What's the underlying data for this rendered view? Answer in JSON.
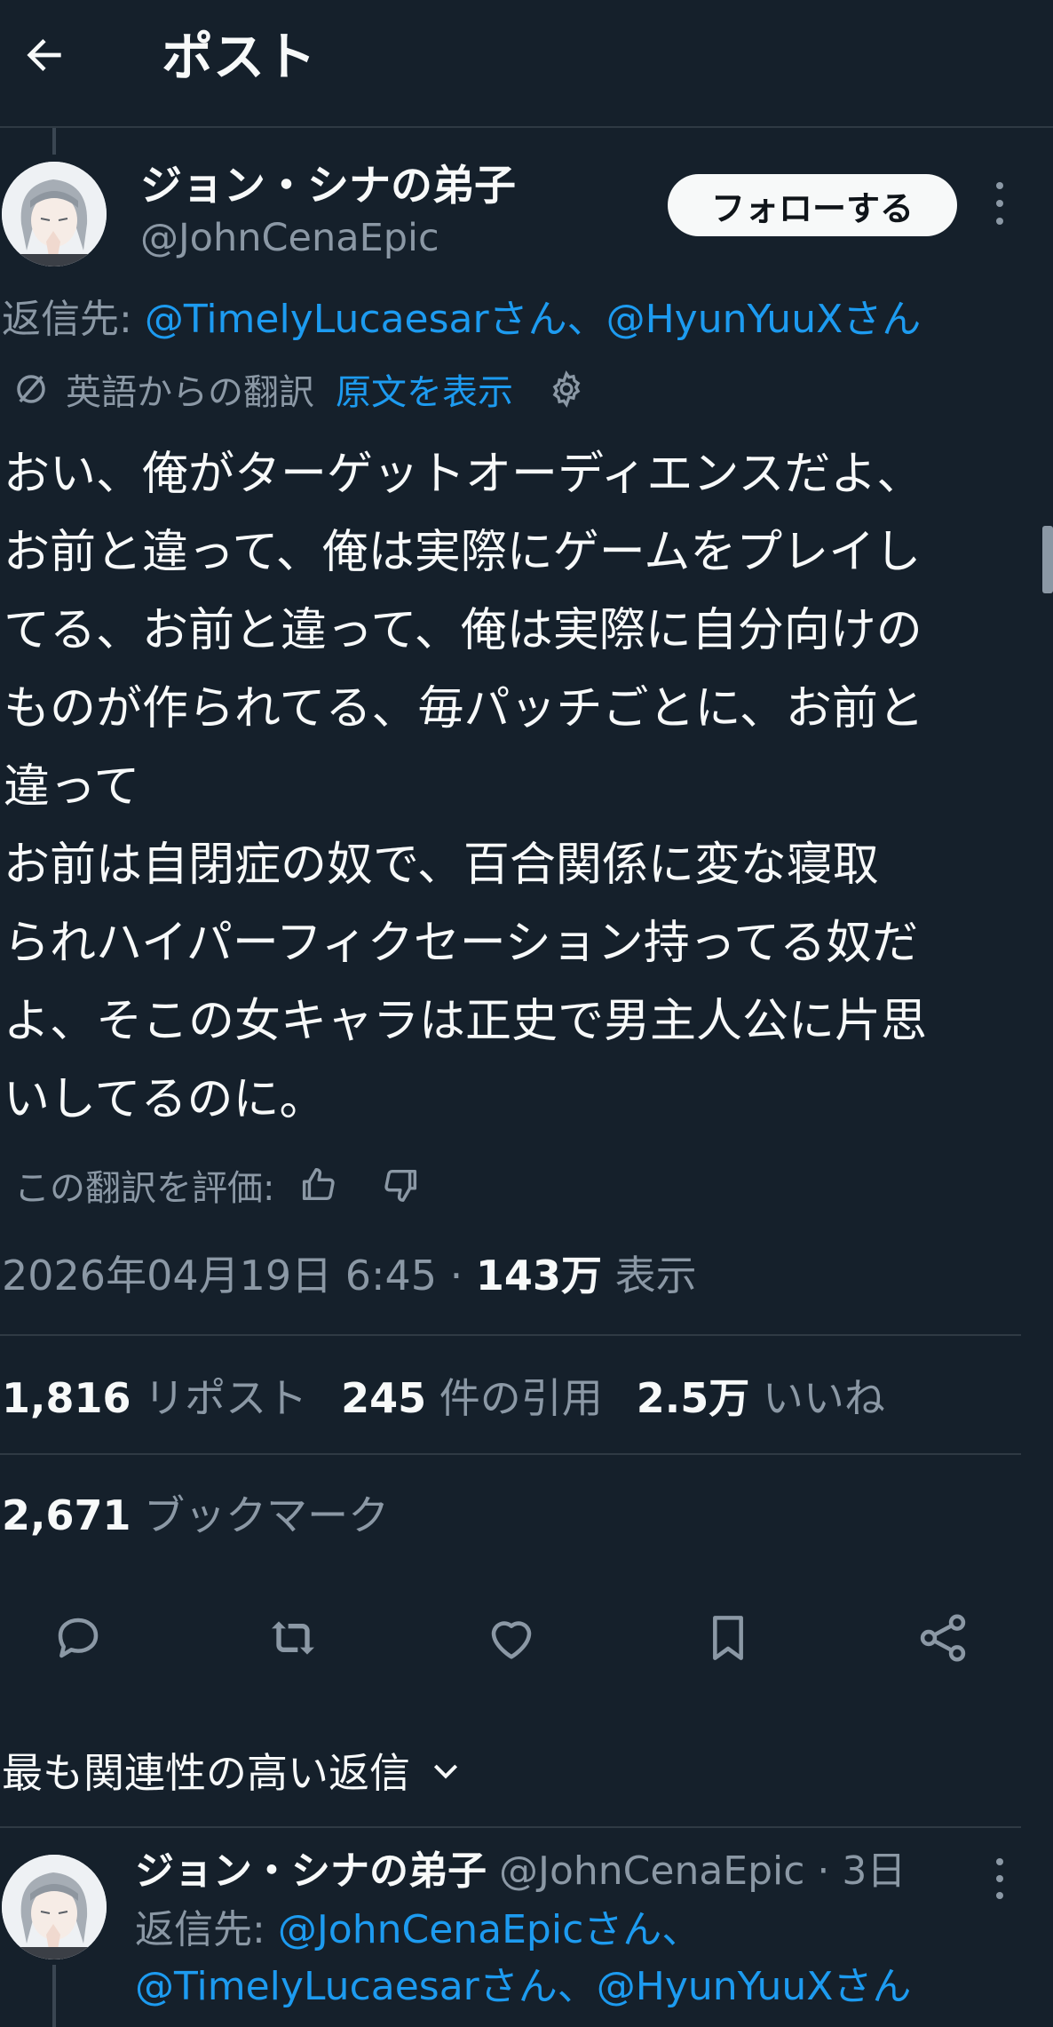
{
  "header": {
    "title": "ポスト"
  },
  "post": {
    "author_name": "ジョン・シナの弟子",
    "author_handle": "@JohnCenaEpic",
    "follow_label": "フォローする",
    "reply_prefix": "返信先: ",
    "reply_mentions": "@TimelyLucaesarさん、@HyunYuuXさん",
    "translation_label": "英語からの翻訳",
    "show_original": "原文を表示",
    "text": "おい、俺がターゲットオーディエンスだよ、\nお前と違って、俺は実際にゲームをプレイし\nてる、お前と違って、俺は実際に自分向けの\nものが作られてる、毎パッチごとに、お前と\n違って\nお前は自閉症の奴で、百合関係に変な寝取\nられハイパーフィクセーション持ってる奴だ\nよ、そこの女キャラは正史で男主人公に片思\nいしてるのに。",
    "rate_label": "この翻訳を評価:",
    "timestamp": "2026年04月19日 6:45 · ",
    "views_count": "143万",
    "views_label": " 表示",
    "reposts_count": "1,816",
    "reposts_label": " リポスト",
    "quotes_count": "245",
    "quotes_label": " 件の引用",
    "likes_count": "2.5万",
    "likes_label": " いいね",
    "bookmarks_count": "2,671",
    "bookmarks_label": " ブックマーク"
  },
  "actions": [
    "reply-icon",
    "repost-icon",
    "like-icon",
    "bookmark-icon",
    "share-icon"
  ],
  "replies_sort": {
    "label": "最も関連性の高い返信"
  },
  "reply": {
    "author_name": "ジョン・シナの弟子",
    "author_meta": " @JohnCenaEpic · 3日",
    "reply_prefix": "返信先: ",
    "reply_line1": "@JohnCenaEpicさん、",
    "reply_line2": "@TimelyLucaesarさん、@HyunYuuXさん"
  },
  "colors": {
    "background": "#15202b",
    "text": "#f7f9f9",
    "secondary": "#8b98a5",
    "accent": "#1d9bf0",
    "divider": "#2f3a44"
  }
}
